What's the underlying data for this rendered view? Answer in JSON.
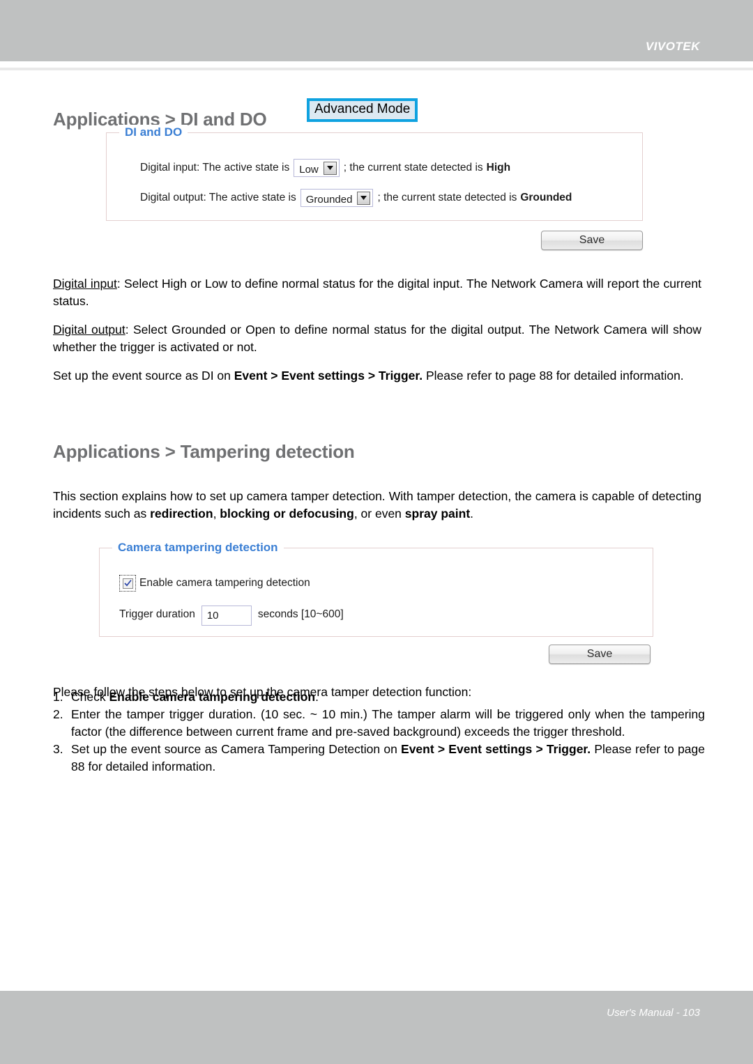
{
  "header": {
    "brand": "VIVOTEK"
  },
  "footer": {
    "text": "User's Manual - 103"
  },
  "sections": {
    "di_do": {
      "title": "Applications > DI and DO",
      "advanced_mode_label": "Advanced Mode",
      "panel": {
        "legend": "DI and DO",
        "digital_input": {
          "prefix": "Digital input: The active state is",
          "selected": "Low",
          "options": [
            "High",
            "Low"
          ],
          "suffix": "; the current state detected is",
          "current_state": "High"
        },
        "digital_output": {
          "prefix": "Digital output: The active state is",
          "selected": "Grounded",
          "options": [
            "Grounded",
            "Open"
          ],
          "suffix": "; the current state detected is",
          "current_state": "Grounded"
        }
      },
      "save_label": "Save",
      "paragraphs": {
        "digital_input_label": "Digital input",
        "digital_input_body": ": Select High or Low to define normal status for the digital input. The Network Camera will report the current status.",
        "digital_output_label": "Digital output",
        "digital_output_body": ": Select Grounded or Open to define normal status for the digital output. The Network Camera will show whether the trigger is activated or not.",
        "event_source_pre": "Set up the event source as DI on ",
        "event_source_bold": "Event > Event settings > Trigger.",
        "event_source_post": " Please refer to page 88 for detailed information."
      }
    },
    "tampering": {
      "title": "Applications > Tampering detection",
      "intro_pre": "This section explains how to set up camera tamper detection. With tamper detection, the camera is capable of detecting incidents such as ",
      "intro_bold_1": "redirection",
      "intro_mid_1": ", ",
      "intro_bold_2": "blocking or defocusing",
      "intro_mid_2": ", or even ",
      "intro_bold_3": "spray paint",
      "intro_post": ".",
      "panel": {
        "legend": "Camera tampering detection",
        "enable_label": "Enable camera tampering detection",
        "enable_checked": true,
        "duration_label": "Trigger duration",
        "duration_value": "10",
        "duration_units": "seconds [10~600]"
      },
      "save_label": "Save",
      "steps_intro": "Please follow the steps below to set up the camera tamper detection function:",
      "steps": [
        {
          "num": "1.",
          "pre": "Check ",
          "bold": "Enable camera tampering detection",
          "post": "."
        },
        {
          "num": "2.",
          "pre": "Enter the tamper trigger duration. (10 sec. ~ 10 min.) The tamper alarm will be triggered only when the tampering factor (the difference between current frame and pre-saved background) exceeds the trigger threshold.",
          "bold": "",
          "post": ""
        },
        {
          "num": "3.",
          "pre": "Set up the event source as Camera Tampering Detection on ",
          "bold": "Event > Event settings > Trigger.",
          "post": " Please refer to page 88 for detailed information."
        }
      ]
    }
  },
  "colors": {
    "header_bar": "#bfc1c1",
    "heading_gray": "#6f7072",
    "legend_blue": "#3b7fd4",
    "accent_blue": "#0fa2e0",
    "panel_border": "#e3cfcf"
  }
}
